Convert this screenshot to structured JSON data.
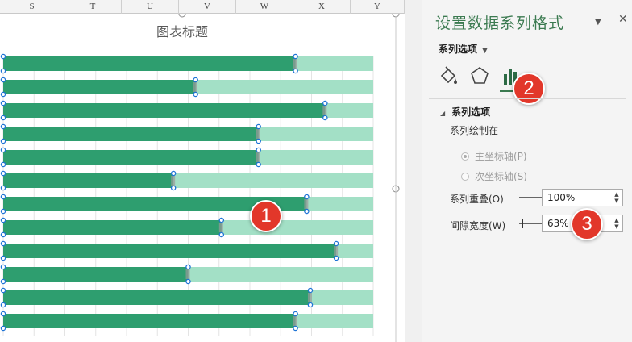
{
  "sheet": {
    "columns": [
      "S",
      "T",
      "U",
      "V",
      "W",
      "X",
      "Y"
    ]
  },
  "chart_data": {
    "type": "bar",
    "title": "图表标题",
    "xlim": [
      0,
      1
    ],
    "series": [
      {
        "values": [
          0.79,
          0.52,
          0.87,
          0.69,
          0.69,
          0.46,
          0.82,
          0.59,
          0.9,
          0.5,
          0.83,
          0.79
        ]
      },
      {
        "values": [
          1,
          1,
          1,
          1,
          1,
          1,
          1,
          1,
          1,
          1,
          1,
          1
        ]
      }
    ],
    "colors": {
      "value_bar": "#2e9e6f",
      "background_bar": "#a3e0c6",
      "handle": "#1f74d6"
    },
    "gridlines": true
  },
  "pane": {
    "title": "设置数据系列格式",
    "options_label": "系列选项",
    "tabs": [
      {
        "name": "fill-line",
        "icon": "paint-bucket-icon"
      },
      {
        "name": "effects",
        "icon": "pentagon-icon"
      },
      {
        "name": "series-options",
        "icon": "bar-chart-icon",
        "selected": true
      }
    ],
    "section": {
      "label": "系列选项",
      "plot_on_label": "系列绘制在",
      "primary_axis": {
        "label": "主坐标轴(P)",
        "selected": true
      },
      "secondary_axis": {
        "label": "次坐标轴(S)",
        "selected": false
      },
      "overlap": {
        "label": "系列重叠(O)",
        "value": "100%",
        "level": 1.0
      },
      "gap_width": {
        "label": "间隙宽度(W)",
        "value": "63%",
        "level": 0.126
      }
    }
  },
  "callouts": [
    "1",
    "2",
    "3"
  ]
}
